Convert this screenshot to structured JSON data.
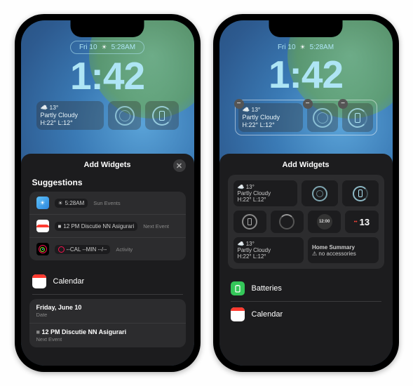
{
  "phone1": {
    "date_pill": {
      "day": "Fri 10",
      "time": "5:28AM"
    },
    "clock": "1:42",
    "weather_widget": {
      "icon": "☁️",
      "temp": "13°",
      "condition": "Partly Cloudy",
      "hilo": "H:22° L:12°"
    },
    "sheet": {
      "title": "Add Widgets",
      "suggestions_heading": "Suggestions",
      "suggestions": [
        {
          "app": "weather",
          "title": "5:28AM",
          "subtitle": "Sun Events"
        },
        {
          "app": "calendar",
          "title": "12 PM Discutie NN Asigurari",
          "subtitle": "Next Event"
        },
        {
          "app": "activity",
          "title": "--CAL --MIN --/--",
          "subtitle": "Activity"
        }
      ],
      "calendar_section": {
        "heading": "Calendar",
        "rows": [
          {
            "title": "Friday, June 10",
            "subtitle": "Date"
          },
          {
            "title": "12 PM Discutie NN Asigurari",
            "subtitle": "Next Event"
          }
        ]
      }
    }
  },
  "phone2": {
    "date_pill": {
      "day": "Fri 10",
      "time": "5:28AM"
    },
    "clock": "1:42",
    "weather_widget": {
      "icon": "☁️",
      "temp": "13°",
      "condition": "Partly Cloudy",
      "hilo": "H:22° L:12°"
    },
    "sheet": {
      "title": "Add Widgets",
      "preview": {
        "row1": {
          "weather": {
            "icon": "☁️",
            "temp": "13°",
            "condition": "Partly Cloudy",
            "hilo": "H:22° L:12°"
          }
        },
        "row2": {
          "clock_label": "12:00",
          "cal_day": "13",
          "cal_dots": "••"
        },
        "row3": {
          "weather": {
            "icon": "☁️",
            "temp": "13°",
            "condition": "Partly Cloudy",
            "hilo": "H:22° L:12°"
          },
          "home": {
            "title": "Home Summary",
            "subtitle": "⚠ no accessories"
          }
        }
      },
      "lists": [
        {
          "icon": "batteries",
          "label": "Batteries"
        },
        {
          "icon": "calendar",
          "label": "Calendar"
        }
      ]
    }
  }
}
